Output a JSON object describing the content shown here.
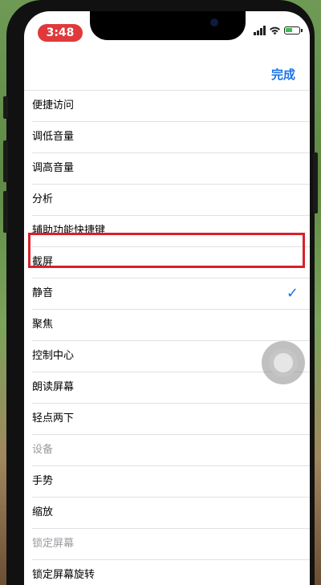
{
  "status_bar": {
    "time": "3:48",
    "time_pill_color": "#e0393b",
    "icons": [
      "signal-icon",
      "wifi-icon",
      "battery-icon"
    ]
  },
  "navbar": {
    "done_label": "完成",
    "accent_color": "#1a73e8"
  },
  "list": {
    "items": [
      {
        "label": "便捷访问",
        "type": "option"
      },
      {
        "label": "调低音量",
        "type": "option"
      },
      {
        "label": "调高音量",
        "type": "option"
      },
      {
        "label": "分析",
        "type": "option"
      },
      {
        "label": "辅助功能快捷键",
        "type": "option"
      },
      {
        "label": "截屏",
        "type": "option",
        "highlighted": true
      },
      {
        "label": "静音",
        "type": "option",
        "selected": true
      },
      {
        "label": "聚焦",
        "type": "option"
      },
      {
        "label": "控制中心",
        "type": "option"
      },
      {
        "label": "朗读屏幕",
        "type": "option"
      },
      {
        "label": "轻点两下",
        "type": "option"
      },
      {
        "label": "设备",
        "type": "section-header"
      },
      {
        "label": "手势",
        "type": "option"
      },
      {
        "label": "缩放",
        "type": "option"
      },
      {
        "label": "锁定屏幕",
        "type": "section-header"
      },
      {
        "label": "锁定屏幕旋转",
        "type": "option"
      }
    ],
    "check_glyph": "✓",
    "highlight_color": "#d82028"
  }
}
